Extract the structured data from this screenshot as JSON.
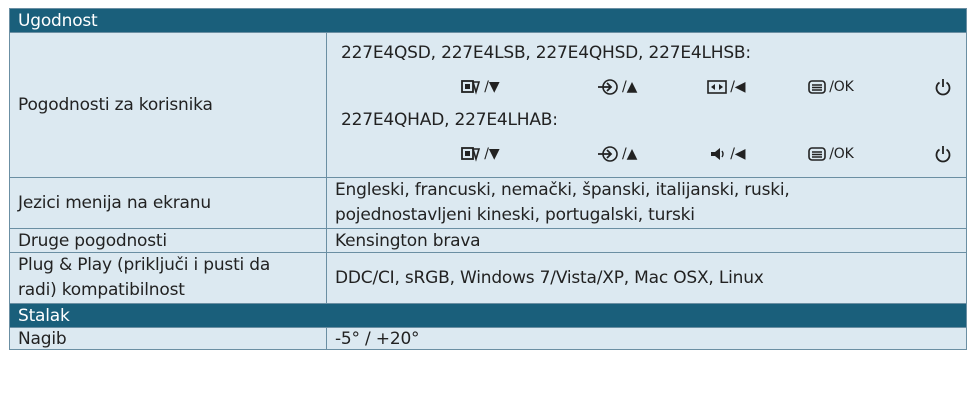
{
  "section_convenience": "Ugodnost",
  "user_features_label": "Pogodnosti za korisnika",
  "models_group1": "227E4QSD, 227E4LSB, 227E4QHSD, 227E4LHSB:",
  "models_group2": "227E4QHAD, 227E4LHAB:",
  "keys_group1": [
    {
      "icon": "smartimage-icon",
      "suffix": "/▼"
    },
    {
      "icon": "input-icon",
      "suffix": "/▲"
    },
    {
      "icon": "aspect-ratio-icon",
      "suffix": "/◀"
    },
    {
      "icon": "menu-icon",
      "suffix": "/OK"
    },
    {
      "icon": "power-icon",
      "suffix": ""
    }
  ],
  "keys_group2": [
    {
      "icon": "smartimage-icon",
      "suffix": "/▼"
    },
    {
      "icon": "input-icon",
      "suffix": "/▲"
    },
    {
      "icon": "volume-icon",
      "suffix": "/◀"
    },
    {
      "icon": "menu-icon",
      "suffix": "/OK"
    },
    {
      "icon": "power-icon",
      "suffix": ""
    }
  ],
  "osd_label": "Jezici menija na ekranu",
  "osd_line1": "Engleski, francuski, nemački, španski, italijanski, ruski,",
  "osd_line2": "pojednostavljeni kineski, portugalski, turski",
  "other_label": "Druge pogodnosti",
  "other_value": "Kensington brava",
  "pnp_label_line1": "Plug & Play (priključi i pusti da",
  "pnp_label_line2": "radi) kompatibilnost",
  "pnp_value": "DDC/CI, sRGB, Windows 7/Vista/XP, Mac OSX, Linux",
  "section_stand": "Stalak",
  "tilt_label": "Nagib",
  "tilt_value": "-5° / +20°",
  "colors": {
    "header": "#1a5f7b",
    "row": "#dce9f1",
    "border": "#6b8fa3"
  }
}
